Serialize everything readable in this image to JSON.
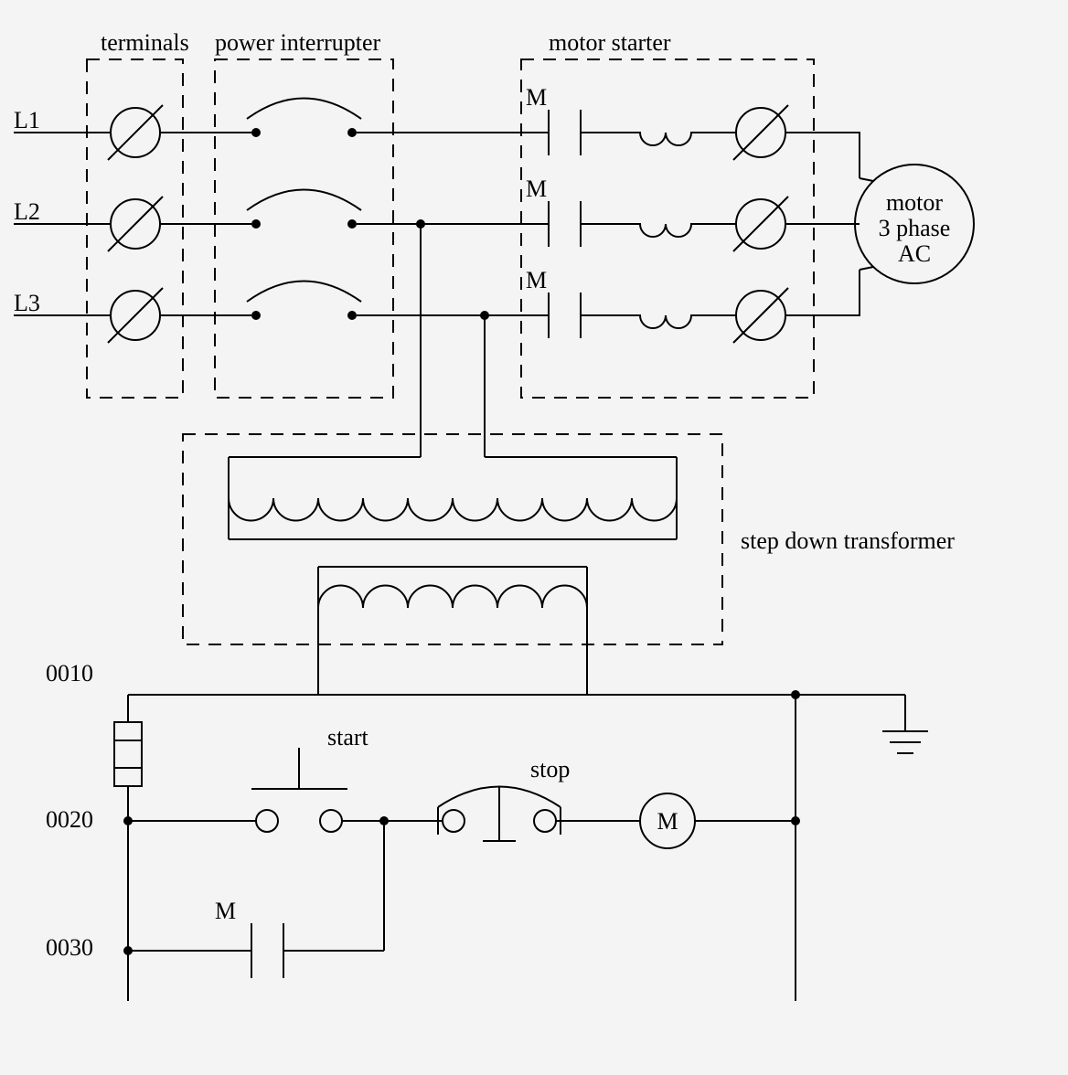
{
  "labels": {
    "terminals": "terminals",
    "power_interrupter": "power interrupter",
    "motor_starter": "motor starter",
    "step_down_transformer": "step down transformer",
    "L1": "L1",
    "L2": "L2",
    "L3": "L3",
    "M_top1": "M",
    "M_top2": "M",
    "M_top3": "M",
    "motor_line1": "motor",
    "motor_line2": "3 phase",
    "motor_line3": "AC",
    "rung0010": "0010",
    "rung0020": "0020",
    "rung0030": "0030",
    "start": "start",
    "stop": "stop",
    "coil_M": "M",
    "contact_M": "M"
  }
}
